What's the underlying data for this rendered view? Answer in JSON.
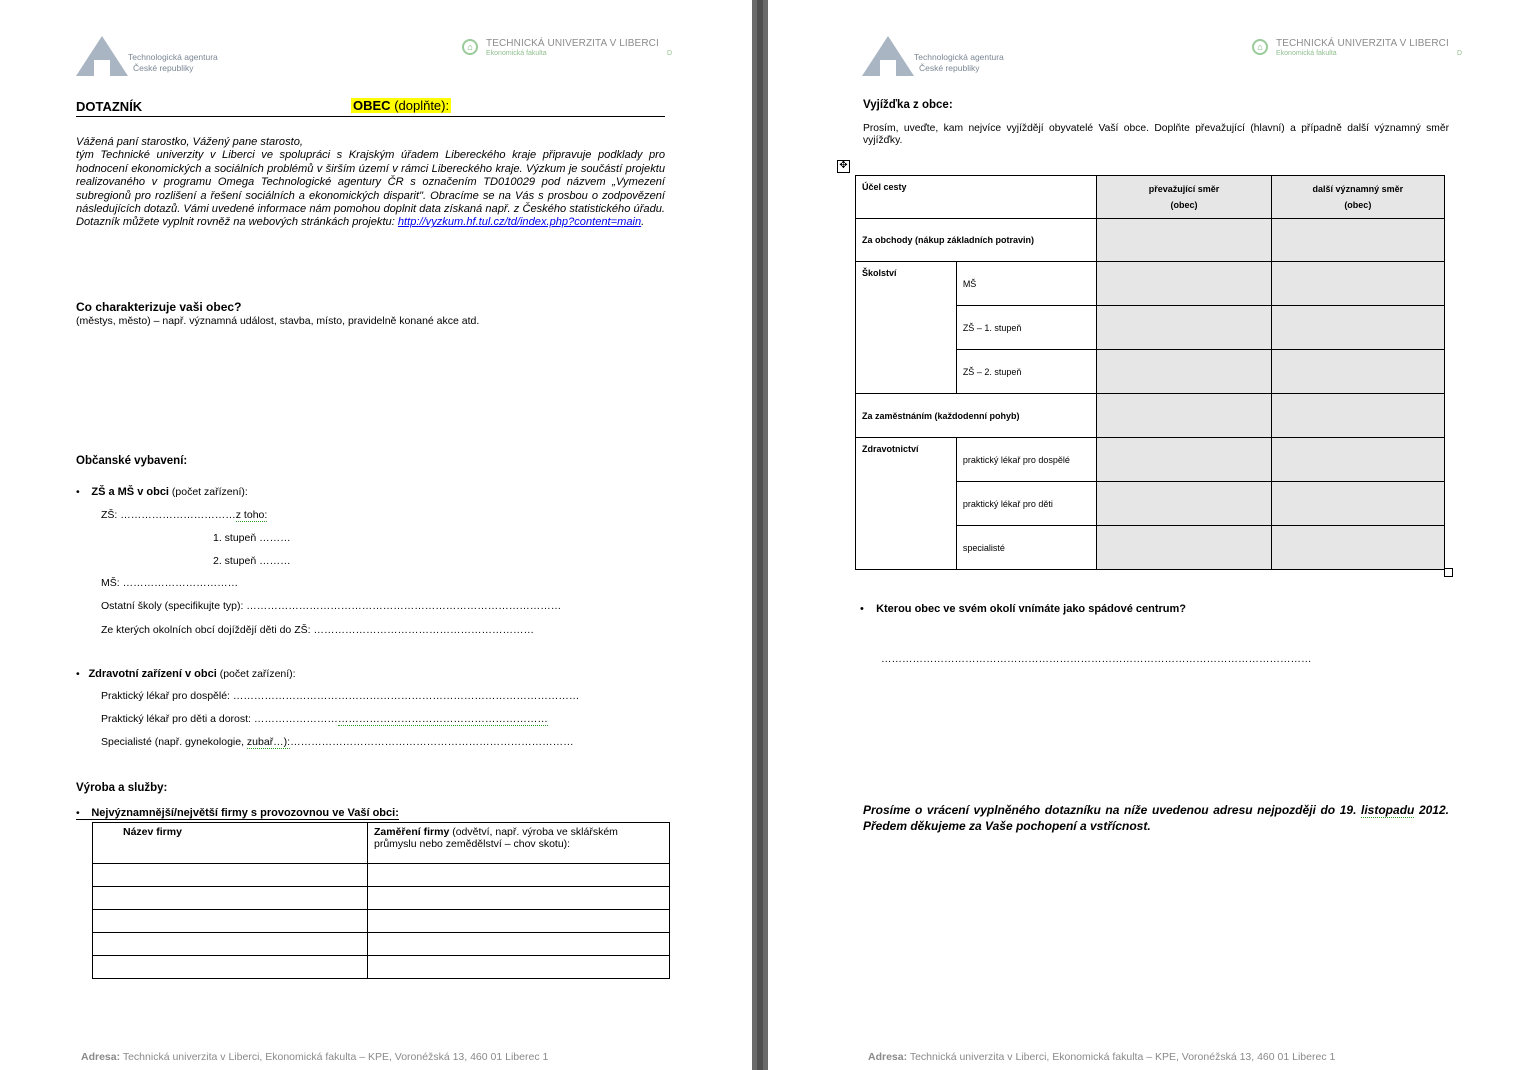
{
  "header": {
    "ta_line1": "Technologická agentura",
    "ta_line2": "České republiky",
    "tul_name": "TECHNICKÁ UNIVERZITA V LIBERCI",
    "tul_faculty": "Ekonomická fakulta",
    "tul_code": "D"
  },
  "page1": {
    "title": "DOTAZNÍK",
    "obec_label": "OBEC",
    "obec_hint": "(doplňte):",
    "intro_salutation": "Vážená paní starostko, Vážený pane starosto,",
    "intro_body": "tým Technické univerzity v Liberci ve spolupráci s Krajským úřadem Libereckého kraje připravuje podklady pro hodnocení ekonomických a sociálních problémů v širším území v rámci Libereckého kraje. Výzkum je součástí projektu realizovaného v programu Omega Technologické agentury ČR s označením TD010029 pod názvem „Vymezení subregionů pro rozlišení a řešení sociálních a ekonomických disparit\". Obracíme se na Vás s prosbou o zodpovězení následujících dotazů. Vámi uvedené informace nám pomohou doplnit data získaná např. z Českého statistického úřadu. Dotazník můžete vyplnit rovněž na webových stránkách projektu: ",
    "intro_link": "http://vyzkum.hf.tul.cz/td/index.php?content=main",
    "intro_end": ".",
    "q1_heading": "Co charakterizuje vaši obec?",
    "q1_hint": "(městys, město) – např. významná událost, stavba, místo, pravidelně konané akce atd.",
    "civic_heading": "Občanské vybavení:",
    "schools_bold": "ZŠ a MŠ v obci",
    "schools_hint": " (počet zařízení):",
    "zs_line": "ZŠ:  ……………………………",
    "zs_tail": "z toho:",
    "stage1": "1.   stupeň ………",
    "stage2": "2.   stupeň ………",
    "ms_line": "MŠ: ……………………………",
    "other_schools": "Ostatní školy (specifikujte typ): ………………………………………………………………………………",
    "commute_line": "Ze kterých okolních obcí dojíždějí děti do ZŠ: ………………………………………………………",
    "health_bold": "Zdravotní zařízení v obci",
    "health_hint": " (počet zařízení):",
    "gp_adult": "Praktický lékař pro dospělé: ………………………………………………………………………………………",
    "gp_child": "Praktický lékař pro děti a dorost: ……………………",
    "gp_child_tail": "……………………………………………………",
    "specialists": "Specialisté (např. gynekologie, ",
    "specialists_sq": "zubař…):",
    "specialists_tail": "………………………………………………………………………",
    "prod_heading": "Výroba a služby:",
    "firms_bullet": "Nejvýznamnější/největší firmy s provozovnou ve Vaší obci:",
    "firms_col1": "Název firmy",
    "firms_col2_bold": "Zaměření firmy",
    "firms_col2_rest": " (odvětví, např. výroba ve sklářském průmyslu nebo zemědělství – chov skotu):",
    "footer_label": "Adresa:",
    "footer_text": " Technická univerzita v Liberci, Ekonomická fakulta – KPE, Voronéžská 13, 460 01 Liberec 1"
  },
  "page2": {
    "heading": "Vyjížďka z obce:",
    "intro": "Prosím, uveďte, kam nejvíce vyjíždějí obyvatelé Vaší obce. Doplňte převažující (hlavní) a případně další významný směr vyjížďky.",
    "table": {
      "col1": "Účel cesty",
      "col2": "převažující směr",
      "col3": "další významný směr",
      "sub": "(obec)",
      "r_shop": "Za obchody (nákup základních potravin)",
      "r_school": "Školství",
      "r_ms": "MŠ",
      "r_zs1": "ZŠ – 1. stupeň",
      "r_zs2": "ZŠ – 2. stupeň",
      "r_work": "Za zaměstnáním (každodenní pohyb)",
      "r_health": "Zdravotnictví",
      "r_gp_adult": "praktický lékař pro dospělé",
      "r_gp_child": "praktický lékař pro děti",
      "r_spec": "specialisté"
    },
    "q_center": "Kterou obec ve svém okolí vnímáte jako spádové centrum?",
    "answer_line": "……………………………………………………………………………………………………………",
    "closing_a": "Prosíme o vrácení vyplněného dotazníku na níže uvedenou adresu nejpozději do 19. ",
    "closing_sq": "listopadu",
    "closing_b": " 2012. Předem děkujeme za Vaše pochopení a vstřícnost."
  }
}
